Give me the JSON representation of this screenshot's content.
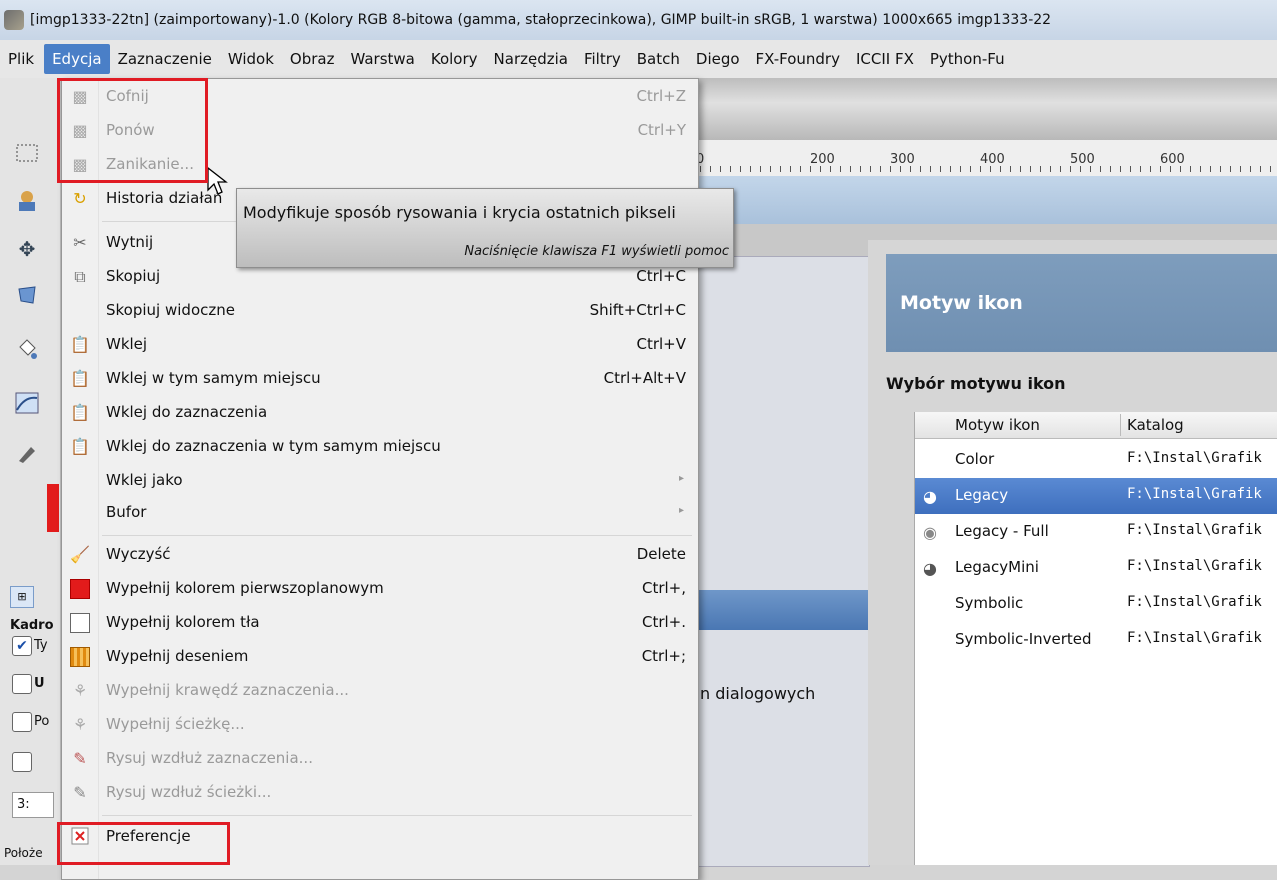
{
  "window": {
    "title": "[imgp1333-22tn] (zaimportowany)-1.0 (Kolory RGB 8-bitowa (gamma, stałoprzecinkowa), GIMP built-in sRGB, 1 warstwa) 1000x665 imgp1333-22"
  },
  "menubar": {
    "items": [
      "Plik",
      "Edycja",
      "Zaznaczenie",
      "Widok",
      "Obraz",
      "Warstwa",
      "Kolory",
      "Narzędzia",
      "Filtry",
      "Batch",
      "Diego",
      "FX-Foundry",
      "ICCII FX",
      "Python-Fu"
    ]
  },
  "edit_menu": {
    "undo": {
      "label": "Cofnij",
      "accel": "Ctrl+Z"
    },
    "redo": {
      "label": "Ponów",
      "accel": "Ctrl+Y"
    },
    "fade": {
      "label": "Zanikanie..."
    },
    "history": {
      "label": "Historia działań"
    },
    "cut": {
      "label": "Wytnij"
    },
    "copy": {
      "label": "Skopiuj",
      "accel": "Ctrl+C"
    },
    "copy_visible": {
      "label": "Skopiuj widoczne",
      "accel": "Shift+Ctrl+C"
    },
    "paste": {
      "label": "Wklej",
      "accel": "Ctrl+V"
    },
    "paste_in_place": {
      "label": "Wklej w tym samym miejscu",
      "accel": "Ctrl+Alt+V"
    },
    "paste_into": {
      "label": "Wklej do zaznaczenia"
    },
    "paste_into_in_place": {
      "label": "Wklej do zaznaczenia w tym samym miejscu"
    },
    "paste_as": {
      "label": "Wklej jako"
    },
    "buffer": {
      "label": "Bufor"
    },
    "clear": {
      "label": "Wyczyść",
      "accel": "Delete"
    },
    "fill_fg": {
      "label": "Wypełnij kolorem pierwszoplanowym",
      "accel": "Ctrl+,"
    },
    "fill_bg": {
      "label": "Wypełnij kolorem tła",
      "accel": "Ctrl+."
    },
    "fill_pattern": {
      "label": "Wypełnij deseniem",
      "accel": "Ctrl+;"
    },
    "fill_selection_outline": {
      "label": "Wypełnij krawędź zaznaczenia..."
    },
    "fill_path": {
      "label": "Wypełnij ścieżkę..."
    },
    "stroke_selection": {
      "label": "Rysuj wzdłuż zaznaczenia..."
    },
    "stroke_path": {
      "label": "Rysuj wzdłuż ścieżki..."
    },
    "preferences": {
      "label": "Preferencje"
    }
  },
  "tooltip": {
    "text": "Modyfikuje sposób rysowania i krycia ostatnich pikseli",
    "hint": "Naciśnięcie klawisza F1 wyświetli pomoc"
  },
  "ruler": {
    "ticks": [
      "0",
      "200",
      "300",
      "400",
      "500",
      "600"
    ]
  },
  "preferences": {
    "nav_partial_text": "n dialogowych",
    "header": "Motyw ikon",
    "section_title": "Wybór motywu ikon",
    "columns": [
      "Motyw ikon",
      "Katalog"
    ],
    "rows": [
      {
        "name": "Color",
        "path": "F:\\Instal\\Grafik"
      },
      {
        "name": "Legacy",
        "path": "F:\\Instal\\Grafik"
      },
      {
        "name": "Legacy - Full",
        "path": "F:\\Instal\\Grafik"
      },
      {
        "name": "LegacyMini",
        "path": "F:\\Instal\\Grafik"
      },
      {
        "name": "Symbolic",
        "path": "F:\\Instal\\Grafik"
      },
      {
        "name": "Symbolic-Inverted",
        "path": "F:\\Instal\\Grafik"
      }
    ]
  },
  "dock": {
    "label_kadro": "Kadro",
    "label_ty": "Ty",
    "label_u": "U",
    "label_po": "Po",
    "value_3": "3:",
    "label_polozenie": "Położe"
  },
  "colors": {
    "highlight_red": "#e01b24",
    "menu_active": "#4a7fc7",
    "selection_blue": "#3e6fbe",
    "fg_fill": "#e21b1b",
    "bg_fill": "#ffffff"
  }
}
